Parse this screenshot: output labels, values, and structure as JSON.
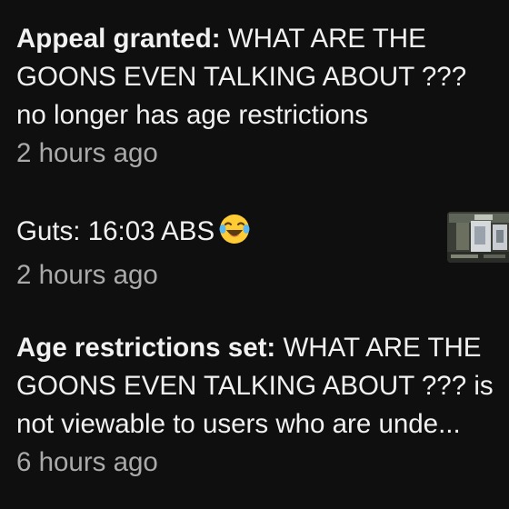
{
  "notifications": [
    {
      "label": "Appeal granted:",
      "lines": [
        " WHAT ARE THE",
        "GOONS EVEN TALKING ABOUT ???",
        "no longer has age restrictions"
      ],
      "time": "2 hours ago"
    },
    {
      "label": "Guts:",
      "lines": [
        " 16:03 ABS"
      ],
      "emoji": "face-with-tears-of-joy-icon",
      "time": "2 hours ago",
      "thumbnail": "video-thumbnail"
    },
    {
      "label": "Age restrictions set:",
      "lines": [
        " WHAT ARE THE",
        "GOONS EVEN TALKING ABOUT ??? is",
        "not viewable to users who are unde..."
      ],
      "time": "6 hours ago"
    }
  ],
  "colors": {
    "background": "#0f0f0f",
    "primary_text": "#f1f1f1",
    "secondary_text": "#aaaaaa"
  }
}
